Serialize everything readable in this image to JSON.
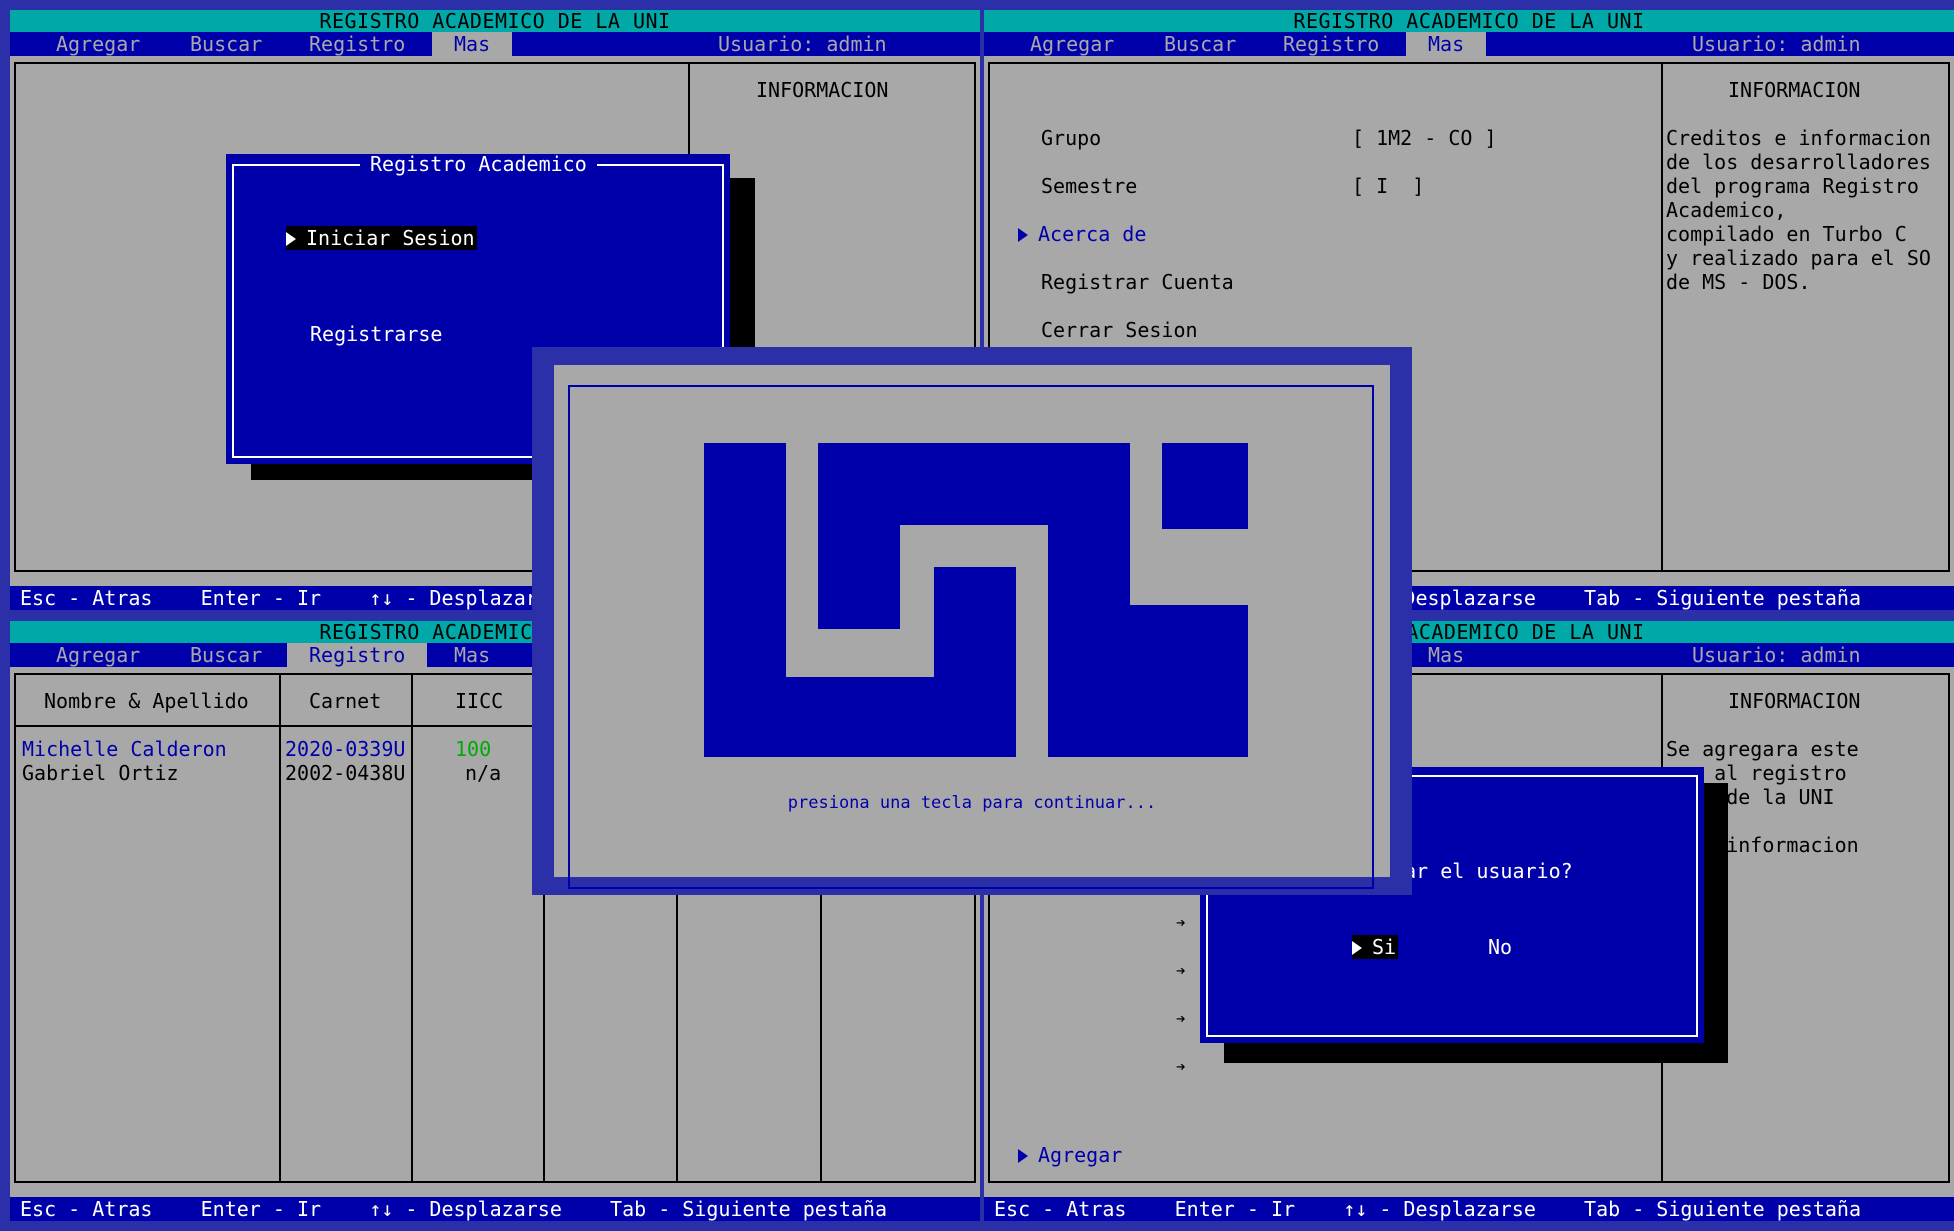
{
  "app": {
    "title": "REGISTRO ACADEMICO DE LA UNI",
    "user": "Usuario: admin"
  },
  "menu": [
    "Agregar",
    "Buscar",
    "Registro",
    "Mas"
  ],
  "status": {
    "esc": "Esc - Atras",
    "enter": "Enter - Ir",
    "scroll": "↑↓ - Desplazarse",
    "tab": "Tab - Siguiente pestaña"
  },
  "info_title": "INFORMACION",
  "login_dialog": {
    "title": "Registro Academico",
    "options": [
      "Iniciar Sesion",
      "Registrarse"
    ]
  },
  "more_menu": {
    "grupo_label": "Grupo",
    "grupo_value": "[ 1M2 - CO ]",
    "semestre_label": "Semestre",
    "semestre_value": "[ I  ]",
    "items": [
      "Acerca de",
      "Registrar Cuenta",
      "Cerrar Sesion"
    ],
    "info_lines": [
      "Creditos e informacion",
      "de los desarrolladores",
      "del programa Registro",
      "Academico,",
      "compilado en Turbo C",
      "y realizado para el SO",
      "de MS - DOS."
    ]
  },
  "registro_table": {
    "headers": [
      "Nombre & Apellido",
      "Carnet",
      "IICC"
    ],
    "rows": [
      {
        "name": "Michelle Calderon",
        "carnet": "2020-0339U",
        "iicc": "100"
      },
      {
        "name": "Gabriel Ortiz",
        "carnet": "2002-0438U",
        "iicc": "n/a"
      }
    ]
  },
  "agregar": {
    "info_lines": [
      "Se agregara este",
      "mno al registro",
      "mico de la UNI",
      "",
      "e la informacion"
    ],
    "question": "egar el usuario?",
    "yes": "Si",
    "no": "No",
    "action": "Agregar"
  },
  "splash": {
    "prompt": "presiona una tecla para continuar..."
  },
  "colors": {
    "blue": "#0000aa",
    "gray": "#a8a8a8",
    "cyan": "#00a8a8",
    "green": "#00aa00",
    "border": "#2b2fa8"
  }
}
